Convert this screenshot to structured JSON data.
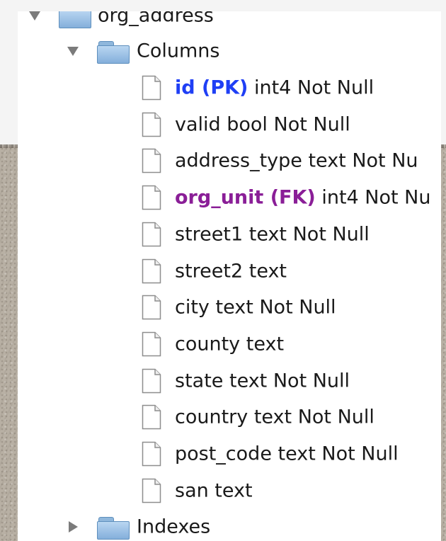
{
  "tree": {
    "table": {
      "label": "org_address",
      "expanded": true
    },
    "columns_folder": {
      "label": "Columns",
      "expanded": true
    },
    "columns": [
      {
        "name": "id (PK)",
        "rest": " int4 Not Null",
        "key": "pk"
      },
      {
        "name": "",
        "rest": "valid bool Not Null",
        "key": ""
      },
      {
        "name": "",
        "rest": "address_type text Not Nu",
        "key": ""
      },
      {
        "name": "org_unit (FK)",
        "rest": " int4 Not Nu",
        "key": "fk"
      },
      {
        "name": "",
        "rest": "street1 text Not Null",
        "key": ""
      },
      {
        "name": "",
        "rest": "street2 text",
        "key": ""
      },
      {
        "name": "",
        "rest": "city text Not Null",
        "key": ""
      },
      {
        "name": "",
        "rest": "county text",
        "key": ""
      },
      {
        "name": "",
        "rest": "state text Not Null",
        "key": ""
      },
      {
        "name": "",
        "rest": "country text Not Null",
        "key": ""
      },
      {
        "name": "",
        "rest": "post_code text Not Null",
        "key": ""
      },
      {
        "name": "",
        "rest": "san text",
        "key": ""
      }
    ],
    "indexes_folder": {
      "label": "Indexes",
      "expanded": false
    }
  },
  "icons": {
    "folder": "folder-icon",
    "file": "document-icon",
    "disclosure_open": "disclosure-triangle-down-icon",
    "disclosure_closed": "disclosure-triangle-right-icon"
  },
  "colors": {
    "primary_key": "#1f3ff5",
    "foreign_key": "#8a1e97",
    "text": "#1a1a1a",
    "folder": "#84afdb"
  }
}
